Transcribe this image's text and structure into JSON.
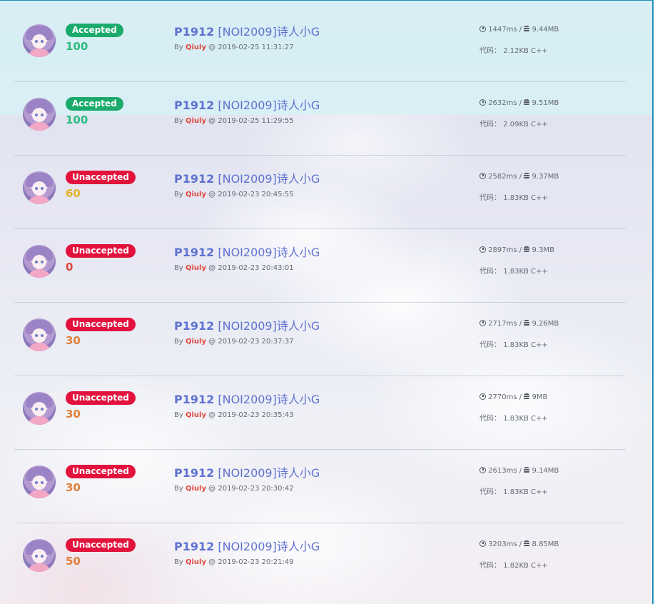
{
  "labels": {
    "by": "By",
    "at": "@",
    "code_prefix": "代码：",
    "slash": "/"
  },
  "colors": {
    "accepted": "#1aaa6b",
    "unaccepted": "#e2123c",
    "score_full": "#2bbd7e",
    "score_mid": "#e2b22a",
    "score_zero": "#e0453a",
    "score_low": "#e0803a",
    "link": "#5f72d0",
    "username": "#e0453a"
  },
  "records": [
    {
      "status": "Accepted",
      "score": "100",
      "pid": "P1912",
      "title": "[NOI2009]诗人小G",
      "user": "Qiuly",
      "time": "2019-02-25 11:31:27",
      "run_time": "1447ms",
      "memory": "9.44MB",
      "code": "2.12KB C++"
    },
    {
      "status": "Accepted",
      "score": "100",
      "pid": "P1912",
      "title": "[NOI2009]诗人小G",
      "user": "Qiuly",
      "time": "2019-02-25 11:29:55",
      "run_time": "2632ms",
      "memory": "9.51MB",
      "code": "2.09KB C++"
    },
    {
      "status": "Unaccepted",
      "score": "60",
      "pid": "P1912",
      "title": "[NOI2009]诗人小G",
      "user": "Qiuly",
      "time": "2019-02-23 20:45:55",
      "run_time": "2582ms",
      "memory": "9.37MB",
      "code": "1.83KB C++"
    },
    {
      "status": "Unaccepted",
      "score": "0",
      "pid": "P1912",
      "title": "[NOI2009]诗人小G",
      "user": "Qiuly",
      "time": "2019-02-23 20:43:01",
      "run_time": "2897ms",
      "memory": "9.3MB",
      "code": "1.83KB C++"
    },
    {
      "status": "Unaccepted",
      "score": "30",
      "pid": "P1912",
      "title": "[NOI2009]诗人小G",
      "user": "Qiuly",
      "time": "2019-02-23 20:37:37",
      "run_time": "2717ms",
      "memory": "9.26MB",
      "code": "1.83KB C++"
    },
    {
      "status": "Unaccepted",
      "score": "30",
      "pid": "P1912",
      "title": "[NOI2009]诗人小G",
      "user": "Qiuly",
      "time": "2019-02-23 20:35:43",
      "run_time": "2770ms",
      "memory": "9MB",
      "code": "1.83KB C++"
    },
    {
      "status": "Unaccepted",
      "score": "30",
      "pid": "P1912",
      "title": "[NOI2009]诗人小G",
      "user": "Qiuly",
      "time": "2019-02-23 20:30:42",
      "run_time": "2613ms",
      "memory": "9.14MB",
      "code": "1.83KB C++"
    },
    {
      "status": "Unaccepted",
      "score": "50",
      "pid": "P1912",
      "title": "[NOI2009]诗人小G",
      "user": "Qiuly",
      "time": "2019-02-23 20:21:49",
      "run_time": "3203ms",
      "memory": "8.85MB",
      "code": "1.82KB C++"
    }
  ]
}
